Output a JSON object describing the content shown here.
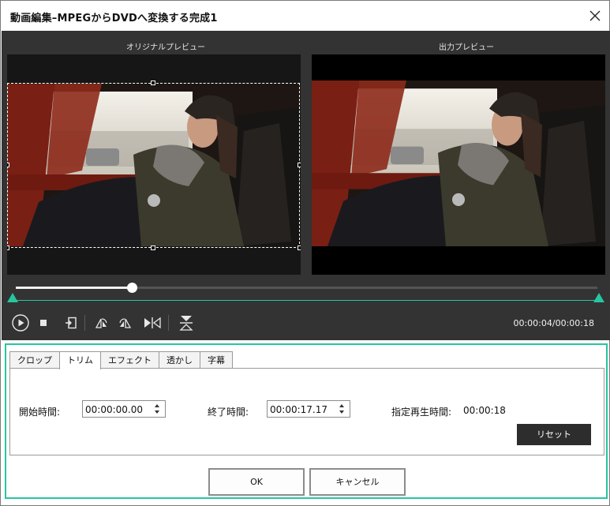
{
  "window": {
    "title": "動画編集–MPEGからDVDへ変換する完成1",
    "close_icon": "close-icon"
  },
  "preview": {
    "original_label": "オリジナルプレビュー",
    "output_label": "出力プレビュー"
  },
  "playback": {
    "progress": 0.2,
    "current_time": "00:00:04",
    "separator": "/",
    "total_time": "00:00:18"
  },
  "toolbar": {
    "icons": [
      "play-icon",
      "stop-icon",
      "snapshot-icon",
      "rotate-left-icon",
      "rotate-right-icon",
      "flip-horizontal-icon",
      "flip-vertical-icon"
    ]
  },
  "tabs": [
    {
      "label": "クロップ",
      "active": false
    },
    {
      "label": "トリム",
      "active": true
    },
    {
      "label": "エフェクト",
      "active": false
    },
    {
      "label": "透かし",
      "active": false
    },
    {
      "label": "字幕",
      "active": false
    }
  ],
  "trim": {
    "start_label": "開始時間:",
    "start_value": "00:00:00.00",
    "end_label": "終了時間:",
    "end_value": "00:00:17.17",
    "duration_label": "指定再生時間:",
    "duration_value": "00:00:18",
    "reset_label": "リセット"
  },
  "dialog": {
    "ok_label": "OK",
    "cancel_label": "キャンセル"
  },
  "colors": {
    "accent": "#27c5a0",
    "dark_bg": "#333333",
    "button_dark": "#2d2d2d"
  }
}
